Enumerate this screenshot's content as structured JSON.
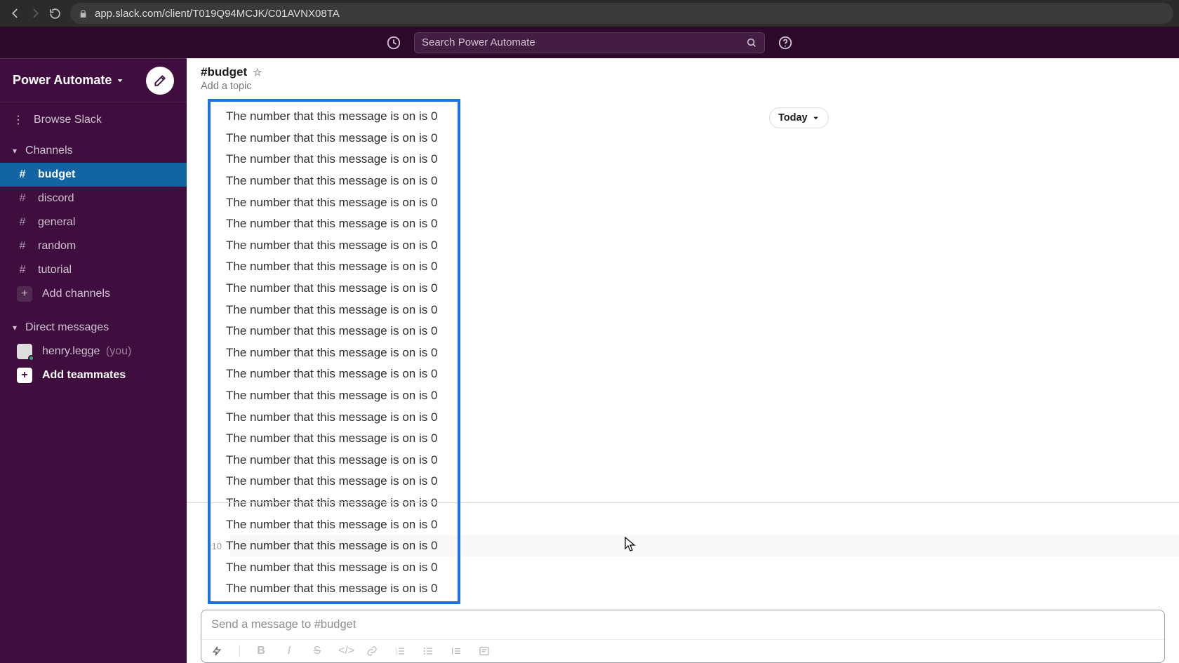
{
  "browser": {
    "url": "app.slack.com/client/T019Q94MCJK/C01AVNX08TA"
  },
  "topbar": {
    "search_placeholder": "Search Power Automate"
  },
  "workspace": {
    "name": "Power Automate"
  },
  "sidebar": {
    "browse_label": "Browse Slack",
    "channels_label": "Channels",
    "channels": [
      {
        "name": "budget",
        "active": true
      },
      {
        "name": "discord",
        "active": false
      },
      {
        "name": "general",
        "active": false
      },
      {
        "name": "random",
        "active": false
      },
      {
        "name": "tutorial",
        "active": false
      }
    ],
    "add_channels_label": "Add channels",
    "dm_label": "Direct messages",
    "self_dm": {
      "name": "henry.legge",
      "you_tag": "(you)"
    },
    "add_teammates_label": "Add teammates"
  },
  "channel": {
    "title": "#budget",
    "topic_placeholder": "Add a topic",
    "date_pill": "Today"
  },
  "messages": {
    "hover_index": 20,
    "hover_timestamp": ":10",
    "lines": [
      "The number that this message is on is 0",
      "The number that this message is on is 0",
      "The number that this message is on is 0",
      "The number that this message is on is 0",
      "The number that this message is on is 0",
      "The number that this message is on is 0",
      "The number that this message is on is 0",
      "The number that this message is on is 0",
      "The number that this message is on is 0",
      "The number that this message is on is 0",
      "The number that this message is on is 0",
      "The number that this message is on is 0",
      "The number that this message is on is 0",
      "The number that this message is on is 0",
      "The number that this message is on is 0",
      "The number that this message is on is 0",
      "The number that this message is on is 0",
      "The number that this message is on is 0",
      "The number that this message is on is 0",
      "The number that this message is on is 0",
      "The number that this message is on is 0",
      "The number that this message is on is 0",
      "The number that this message is on is 0"
    ]
  },
  "composer": {
    "placeholder": "Send a message to #budget"
  }
}
